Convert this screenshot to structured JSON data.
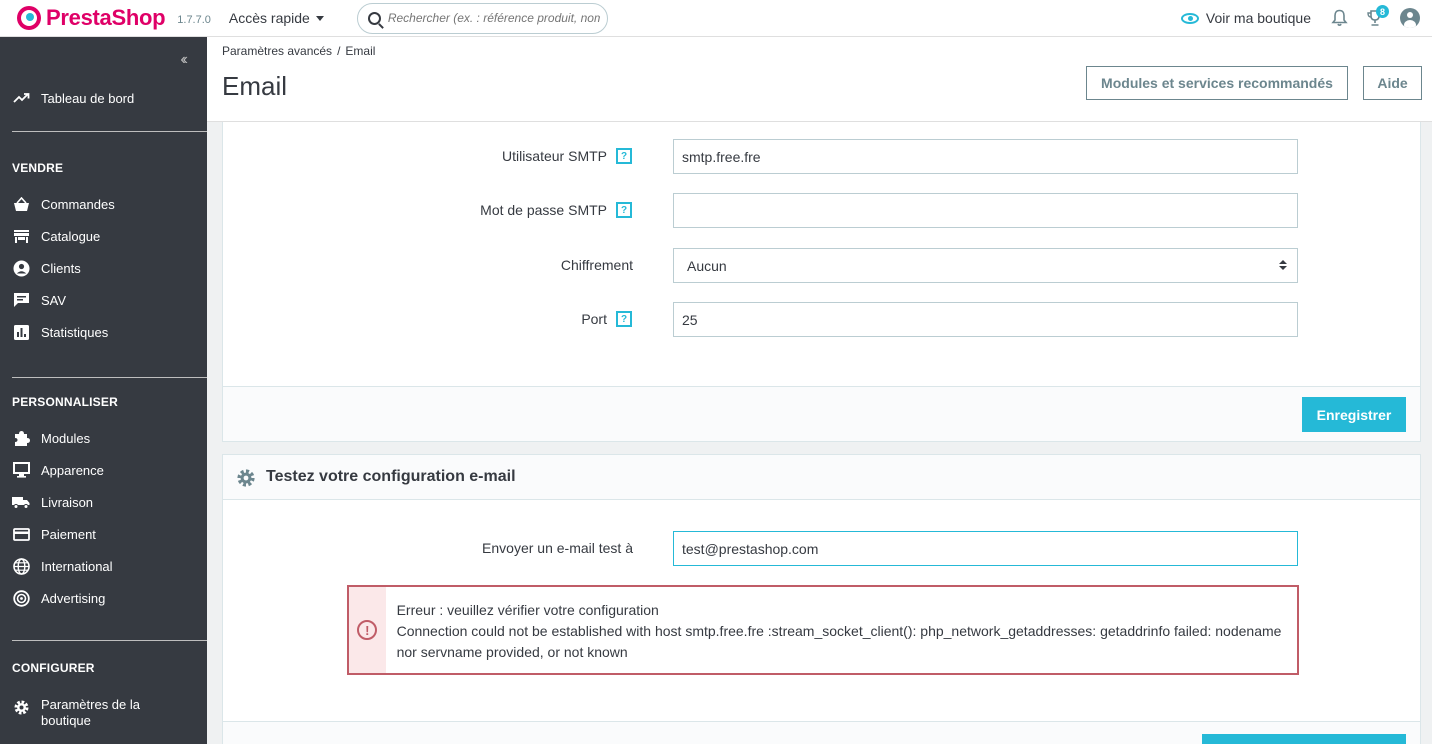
{
  "header": {
    "brand": "PrestaShop",
    "version": "1.7.7.0",
    "quick_access": "Accès rapide",
    "search_placeholder": "Rechercher (ex. : référence produit, nom",
    "view_shop": "Voir ma boutique",
    "notifications_badge": "8"
  },
  "sidebar": {
    "dashboard": "Tableau de bord",
    "sections": {
      "sell": "VENDRE",
      "customize": "PERSONNALISER",
      "configure": "CONFIGURER"
    },
    "sell_items": [
      "Commandes",
      "Catalogue",
      "Clients",
      "SAV",
      "Statistiques"
    ],
    "customize_items": [
      "Modules",
      "Apparence",
      "Livraison",
      "Paiement",
      "International",
      "Advertising"
    ],
    "configure_items": [
      "Paramètres de la boutique"
    ]
  },
  "page": {
    "breadcrumb": [
      "Paramètres avancés",
      "/",
      "Email"
    ],
    "title": "Email",
    "btn_modules": "Modules et services recommandés",
    "btn_help": "Aide"
  },
  "smtp_form": {
    "user_label": "Utilisateur SMTP",
    "user_value": "smtp.free.fre",
    "password_label": "Mot de passe SMTP",
    "password_value": "",
    "encryption_label": "Chiffrement",
    "encryption_value": "Aucun",
    "port_label": "Port",
    "port_value": "25",
    "help_symbol": "?",
    "save_button": "Enregistrer"
  },
  "test_panel": {
    "heading": "Testez votre configuration e-mail",
    "send_label": "Envoyer un e-mail test à",
    "send_value": "test@prestashop.com",
    "error_title": "Erreur : veuillez vérifier votre configuration",
    "error_detail": "Connection could not be established with host smtp.free.fre :stream_socket_client(): php_network_getaddresses: getaddrinfo failed: nodename nor servname provided, or not known",
    "error_icon": "!"
  },
  "colors": {
    "primary": "#25b9d7",
    "brand": "#df0067",
    "sidebar": "#363a41",
    "danger": "#c05c67"
  }
}
